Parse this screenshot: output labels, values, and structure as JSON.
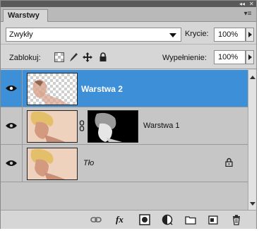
{
  "panel": {
    "tab_label": "Warstwy",
    "collapse_glyph": "◂◂",
    "close_glyph": "✕",
    "menu_glyph": "▾≡"
  },
  "blend": {
    "mode": "Zwykły"
  },
  "opacity": {
    "label": "Krycie:",
    "value": "100%"
  },
  "lock": {
    "label": "Zablokuj:",
    "icons": [
      "lock-transparent-pixels-icon",
      "lock-image-pixels-icon",
      "lock-position-icon",
      "lock-all-icon"
    ]
  },
  "fill": {
    "label": "Wypełnienie:",
    "value": "100%"
  },
  "layers": [
    {
      "name": "Warstwa 2",
      "selected": true,
      "visible": true
    },
    {
      "name": "Warstwa 1",
      "selected": false,
      "visible": true,
      "has_mask": true
    },
    {
      "name": "Tło",
      "selected": false,
      "visible": true,
      "locked": true
    }
  ],
  "colors": {
    "selection": "#3d8fd7",
    "panel_bg": "#d6d6d6",
    "header_bg": "#5a5a5a"
  },
  "bottom_icons": [
    "link-layers-icon",
    "layer-style-fx-icon",
    "add-mask-icon",
    "adjustment-layer-icon",
    "new-group-icon",
    "new-layer-icon",
    "delete-layer-icon"
  ],
  "bottom_fx_label": "fx"
}
